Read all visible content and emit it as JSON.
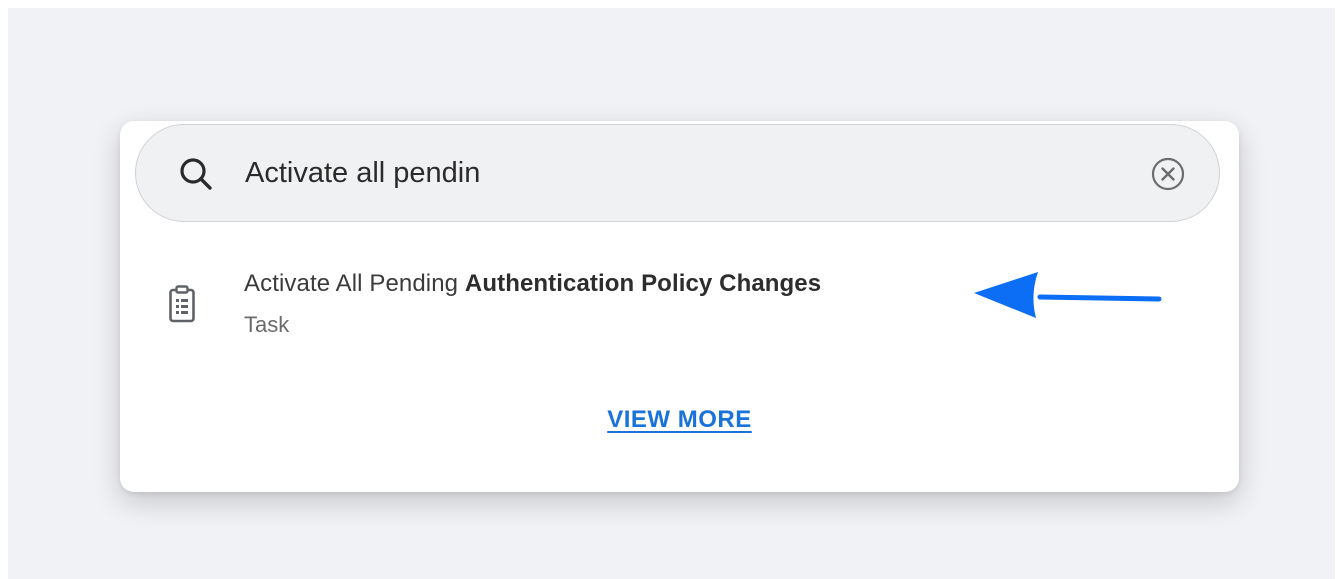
{
  "search": {
    "value": "Activate all pendin",
    "icon": "search-icon",
    "clear_icon": "clear-icon"
  },
  "results": [
    {
      "title_plain": "Activate All Pending",
      "title_bold": "Authentication Policy Changes",
      "subtitle": "Task",
      "icon": "task-icon"
    }
  ],
  "view_more": {
    "label": "VIEW MORE"
  },
  "colors": {
    "accent": "#1a73d9",
    "annotation_arrow": "#0b6ef5",
    "background": "#f1f2f5"
  }
}
